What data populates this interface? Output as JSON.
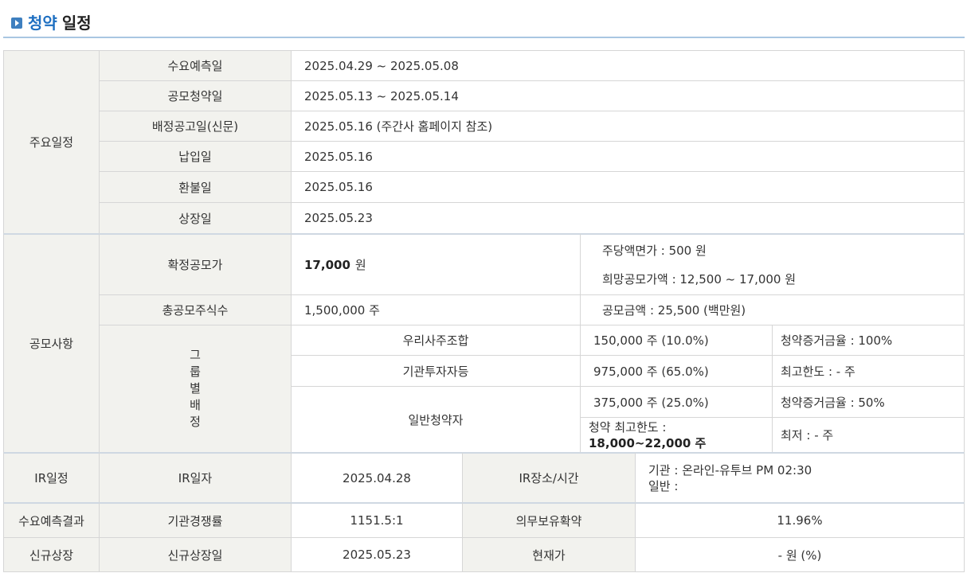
{
  "header": {
    "title_prefix": "청약",
    "title_suffix": "일정"
  },
  "schedule": {
    "section_label": "주요일정",
    "rows": [
      {
        "label": "수요예측일",
        "value": "2025.04.29   ~    2025.05.08"
      },
      {
        "label": "공모청약일",
        "value": "2025.05.13   ~    2025.05.14"
      },
      {
        "label": "배정공고일(신문)",
        "value": "2025.05.16 (주간사 홈페이지 참조)"
      },
      {
        "label": "납입일",
        "value": "2025.05.16"
      },
      {
        "label": "환불일",
        "value": "2025.05.16"
      },
      {
        "label": "상장일",
        "value": "2025.05.23"
      }
    ]
  },
  "offering": {
    "section_label": "공모사항",
    "confirmed_price_label": "확정공모가",
    "confirmed_price_value": "17,000",
    "confirmed_price_unit": "원",
    "face_value": "주당액면가 :  500 원",
    "hope_price": "희망공모가액 :  12,500 ~ 17,000 원",
    "total_shares_label": "총공모주식수",
    "total_shares_value": "1,500,000 주",
    "amount": "공모금액 :  25,500 (백만원)",
    "group_label": [
      "그",
      "룹",
      "별",
      "배",
      "정"
    ],
    "groups": [
      {
        "name": "우리사주조합",
        "shares": "150,000 주  (10.0%)",
        "note": "청약증거금율 : 100%"
      },
      {
        "name": "기관투자자등",
        "shares": "975,000 주  (65.0%)",
        "note": "최고한도 :  - 주"
      },
      {
        "name": "일반청약자",
        "shares": "375,000 주  (25.0%)",
        "note": "청약증거금율 : 50%",
        "limit_label": "청약 최고한도 :",
        "limit_value": "18,000~22,000 주",
        "min_note": "최저 :  - 주"
      }
    ]
  },
  "ir": {
    "section_label": "IR일정",
    "date_label": "IR일자",
    "date_value": "2025.04.28",
    "place_label": "IR장소/시간",
    "place_line1": "기관 : 온라인-유투브 PM 02:30",
    "place_line2": "일반 :"
  },
  "demand": {
    "section_label": "수요예측결과",
    "competition_label": "기관경쟁률",
    "competition_value": "1151.5:1",
    "lockup_label": "의무보유확약",
    "lockup_value": "11.96%"
  },
  "listing": {
    "section_label": "신규상장",
    "date_label": "신규상장일",
    "date_value": "2025.05.23",
    "price_label": "현재가",
    "price_value": "- 원 (%)"
  }
}
